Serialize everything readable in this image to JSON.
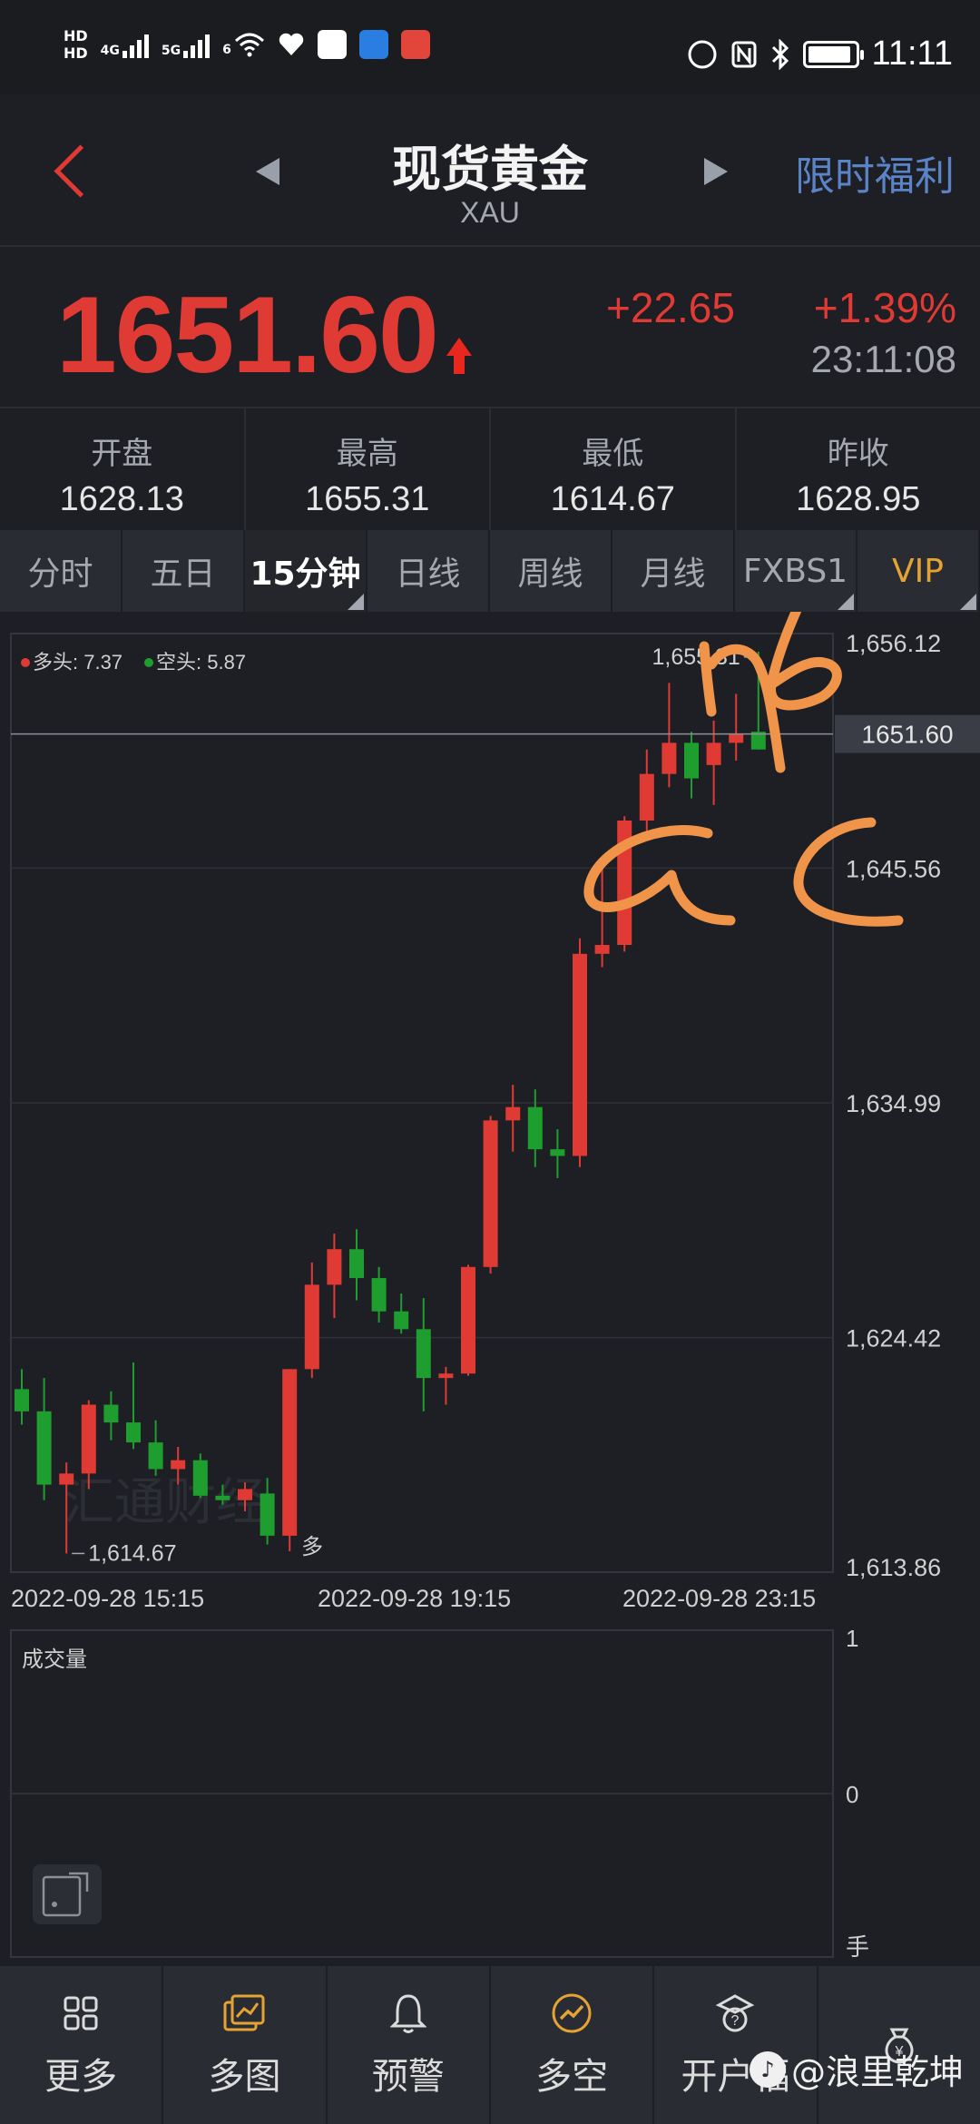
{
  "status_bar": {
    "hd1": "HD",
    "hd2": "HD",
    "net1": "4G",
    "net2": "5G",
    "wifi_badge": "6",
    "time": "11:11"
  },
  "header": {
    "title": "现货黄金",
    "symbol": "XAU",
    "promo": "限时福利"
  },
  "quote": {
    "price": "1651.60",
    "change": "+22.65",
    "change_pct": "+1.39%",
    "time": "23:11:08"
  },
  "stats": [
    {
      "label": "开盘",
      "value": "1628.13"
    },
    {
      "label": "最高",
      "value": "1655.31"
    },
    {
      "label": "最低",
      "value": "1614.67"
    },
    {
      "label": "昨收",
      "value": "1628.95"
    }
  ],
  "tabs": [
    {
      "label": "分时",
      "active": false
    },
    {
      "label": "五日",
      "active": false
    },
    {
      "label": "15分钟",
      "active": true
    },
    {
      "label": "日线",
      "active": false
    },
    {
      "label": "周线",
      "active": false
    },
    {
      "label": "月线",
      "active": false
    },
    {
      "label": "FXBS1",
      "active": false
    },
    {
      "label": "VIP",
      "active": false
    }
  ],
  "colors": {
    "up": "#e03a34",
    "down": "#1e9e2e",
    "accent": "#5b84c8",
    "vip": "#e4a332",
    "annotation": "#f0944a"
  },
  "chart_data": {
    "type": "candlestick",
    "legend": {
      "long_label": "多头: 7.37",
      "short_label": "空头: 5.87"
    },
    "ylim": [
      1613.86,
      1656.12
    ],
    "y_ticks": [
      "1,656.12",
      "1,645.56",
      "1,634.99",
      "1,624.42",
      "1,613.86"
    ],
    "x_ticks": [
      "2022-09-28 15:15",
      "2022-09-28 19:15",
      "2022-09-28 23:15"
    ],
    "current_price_label": "1651.60",
    "current_price": 1651.6,
    "high_label": "1,655.31",
    "low_label": "1,614.67",
    "marker_label": "多",
    "watermark": "汇通财经",
    "candles": [
      {
        "o": 1622.1,
        "h": 1623.0,
        "l": 1620.5,
        "c": 1621.1
      },
      {
        "o": 1621.1,
        "h": 1622.6,
        "l": 1617.1,
        "c": 1617.8
      },
      {
        "o": 1617.8,
        "h": 1618.8,
        "l": 1614.7,
        "c": 1618.3
      },
      {
        "o": 1618.3,
        "h": 1621.6,
        "l": 1617.6,
        "c": 1621.4
      },
      {
        "o": 1621.4,
        "h": 1622.0,
        "l": 1619.8,
        "c": 1620.6
      },
      {
        "o": 1620.6,
        "h": 1623.3,
        "l": 1619.4,
        "c": 1619.7
      },
      {
        "o": 1619.7,
        "h": 1620.7,
        "l": 1618.2,
        "c": 1618.5
      },
      {
        "o": 1618.5,
        "h": 1619.5,
        "l": 1617.8,
        "c": 1618.9
      },
      {
        "o": 1618.9,
        "h": 1619.2,
        "l": 1617.2,
        "c": 1617.3
      },
      {
        "o": 1617.3,
        "h": 1617.8,
        "l": 1616.9,
        "c": 1617.1
      },
      {
        "o": 1617.1,
        "h": 1617.9,
        "l": 1616.6,
        "c": 1617.6
      },
      {
        "o": 1617.4,
        "h": 1618.1,
        "l": 1615.1,
        "c": 1615.5
      },
      {
        "o": 1615.5,
        "h": 1623.0,
        "l": 1614.8,
        "c": 1623.0
      },
      {
        "o": 1623.0,
        "h": 1627.8,
        "l": 1622.6,
        "c": 1626.8
      },
      {
        "o": 1626.8,
        "h": 1629.1,
        "l": 1625.3,
        "c": 1628.4
      },
      {
        "o": 1628.4,
        "h": 1629.3,
        "l": 1626.1,
        "c": 1627.1
      },
      {
        "o": 1627.1,
        "h": 1627.6,
        "l": 1625.1,
        "c": 1625.6
      },
      {
        "o": 1625.6,
        "h": 1626.4,
        "l": 1624.6,
        "c": 1624.8
      },
      {
        "o": 1624.8,
        "h": 1626.2,
        "l": 1621.1,
        "c": 1622.6
      },
      {
        "o": 1622.6,
        "h": 1623.1,
        "l": 1621.4,
        "c": 1622.8
      },
      {
        "o": 1622.8,
        "h": 1627.7,
        "l": 1622.7,
        "c": 1627.6
      },
      {
        "o": 1627.6,
        "h": 1634.4,
        "l": 1627.3,
        "c": 1634.2
      },
      {
        "o": 1634.2,
        "h": 1635.8,
        "l": 1632.8,
        "c": 1634.8
      },
      {
        "o": 1634.8,
        "h": 1635.6,
        "l": 1632.1,
        "c": 1632.9
      },
      {
        "o": 1632.9,
        "h": 1633.8,
        "l": 1631.6,
        "c": 1632.6
      },
      {
        "o": 1632.6,
        "h": 1642.4,
        "l": 1632.1,
        "c": 1641.7
      },
      {
        "o": 1641.7,
        "h": 1645.6,
        "l": 1641.1,
        "c": 1642.1
      },
      {
        "o": 1642.1,
        "h": 1647.9,
        "l": 1641.8,
        "c": 1647.7
      },
      {
        "o": 1647.7,
        "h": 1650.9,
        "l": 1647.2,
        "c": 1649.8
      },
      {
        "o": 1649.8,
        "h": 1653.9,
        "l": 1649.2,
        "c": 1651.2
      },
      {
        "o": 1651.2,
        "h": 1651.7,
        "l": 1648.7,
        "c": 1649.6
      },
      {
        "o": 1650.2,
        "h": 1652.2,
        "l": 1648.4,
        "c": 1651.2
      },
      {
        "o": 1651.2,
        "h": 1653.4,
        "l": 1650.4,
        "c": 1651.6
      },
      {
        "o": 1651.7,
        "h": 1655.31,
        "l": 1650.9,
        "c": 1650.9
      }
    ],
    "volume_panel": {
      "title": "成交量",
      "y_ticks": [
        "1",
        "0"
      ],
      "unit": "手"
    }
  },
  "bottom_nav": [
    {
      "label": "更多",
      "icon": "grid-icon"
    },
    {
      "label": "多图",
      "icon": "multi-chart-icon"
    },
    {
      "label": "预警",
      "icon": "bell-icon"
    },
    {
      "label": "多空",
      "icon": "trend-icon"
    },
    {
      "label": "开户福",
      "icon": "gift-icon"
    },
    {
      "label": "",
      "icon": "moneybag-icon"
    }
  ],
  "watermark_overlay": "@浪里乾坤"
}
